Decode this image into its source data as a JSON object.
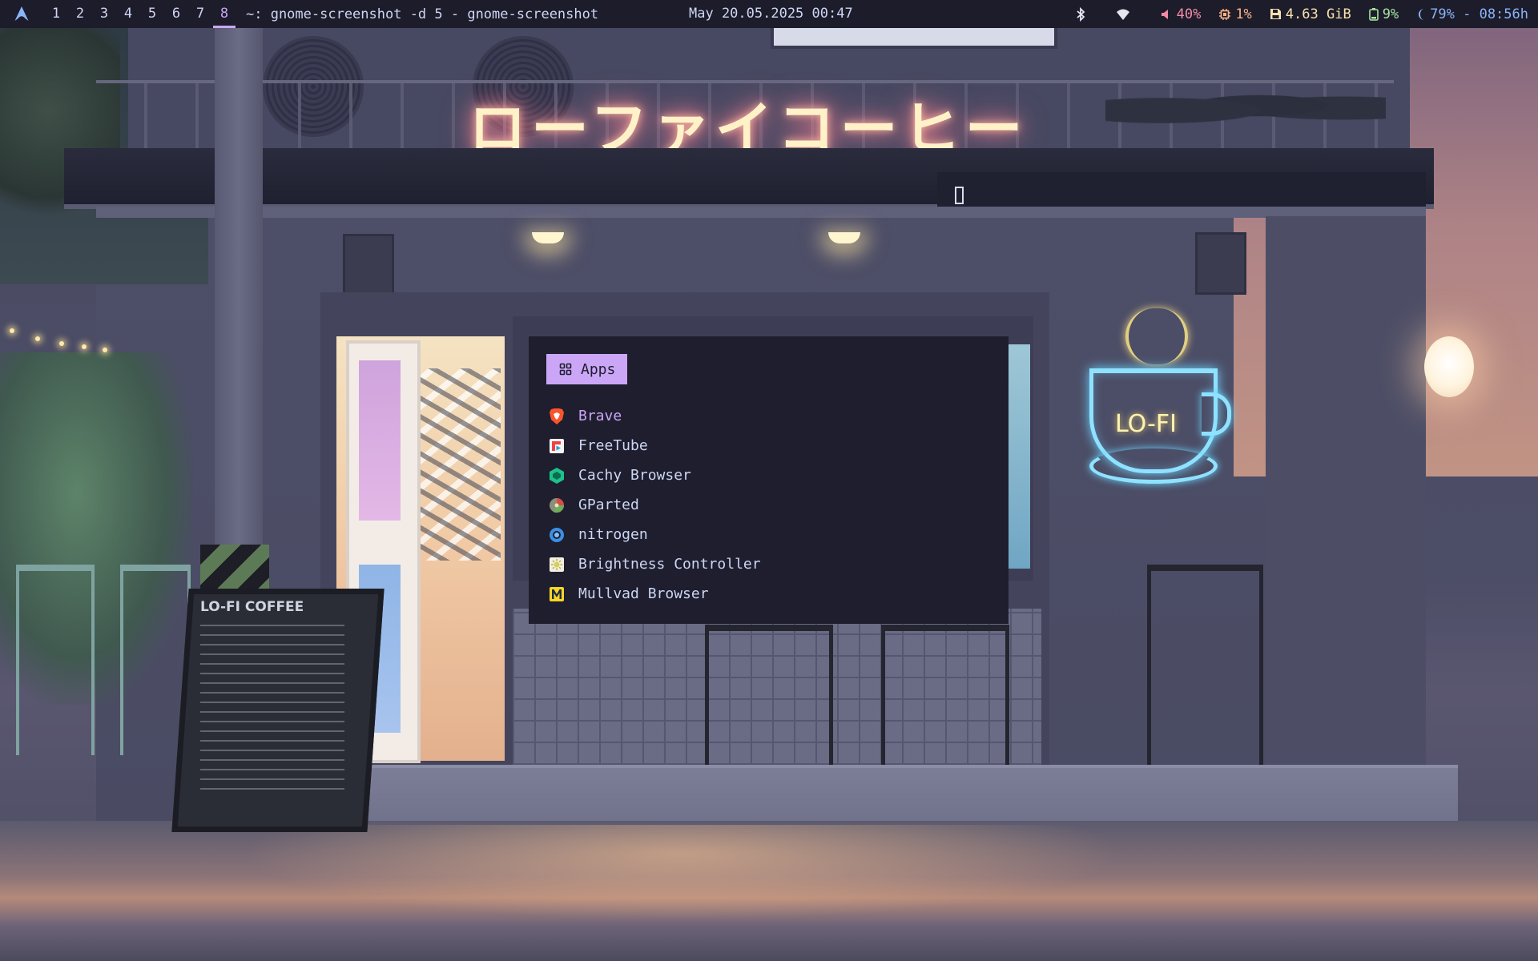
{
  "topbar": {
    "workspaces": [
      "1",
      "2",
      "3",
      "4",
      "5",
      "6",
      "7",
      "8"
    ],
    "active_workspace": "8",
    "window_title": "~: gnome-screenshot -d 5 - gnome-screenshot",
    "clock": "May 20.05.2025 00:47",
    "volume": "40%",
    "cpu": "1%",
    "memory": "4.63 GiB",
    "battery": "9%",
    "brightness_time": "79% - 08:56h"
  },
  "wallpaper": {
    "neon_sign": "ローファイコーヒー",
    "neon_cup_text": "LO-FI",
    "board_title": "LO-FI COFFEE"
  },
  "launcher": {
    "mode_label": "Apps",
    "items": [
      {
        "label": "Brave",
        "icon": "brave-icon",
        "color": "#fb542b"
      },
      {
        "label": "FreeTube",
        "icon": "freetube-icon",
        "color": "#f04242"
      },
      {
        "label": "Cachy Browser",
        "icon": "cachy-browser-icon",
        "color": "#1dc18a"
      },
      {
        "label": "GParted",
        "icon": "gparted-icon",
        "color": "#c7b98a"
      },
      {
        "label": "nitrogen",
        "icon": "nitrogen-icon",
        "color": "#3b8fe6"
      },
      {
        "label": "Brightness Controller",
        "icon": "brightness-icon",
        "color": "#e7e2a0"
      },
      {
        "label": "Mullvad Browser",
        "icon": "mullvad-icon",
        "color": "#ffd524"
      }
    ]
  },
  "colors": {
    "accent": "#cba6f7",
    "bar_bg": "#1d1c2a",
    "launcher_bg": "#1e1e2e",
    "text": "#cdd6f4"
  }
}
